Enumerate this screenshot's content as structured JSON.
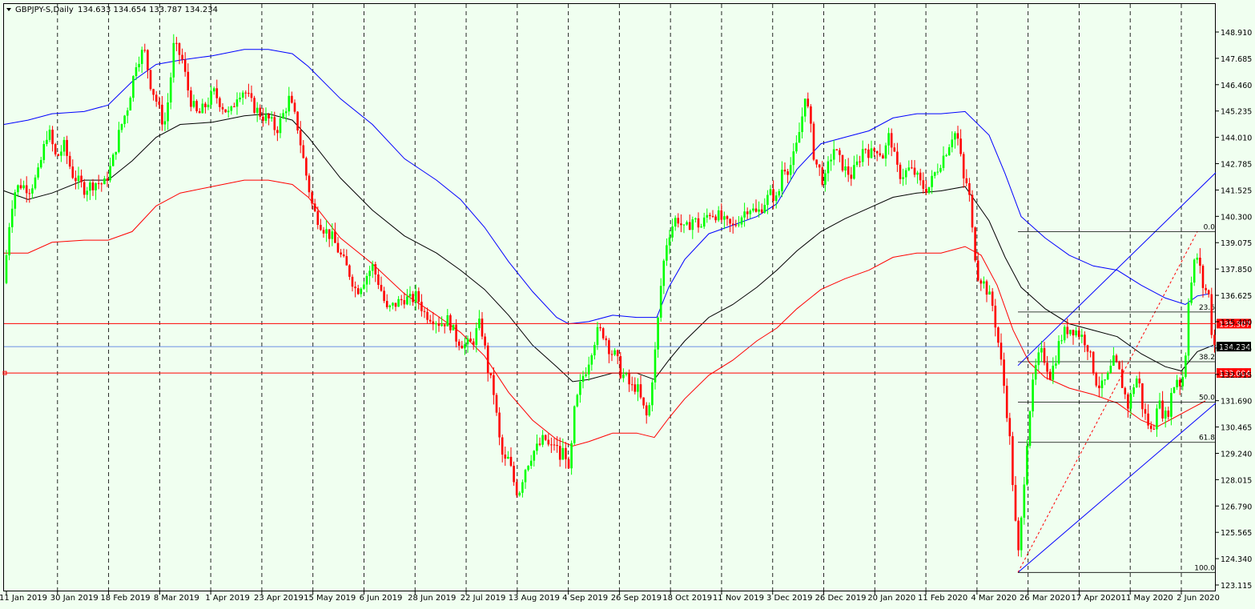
{
  "header": {
    "symbol": "GBPJPY-S,Daily",
    "ohlc": "134.633 134.654 133.787 134.234"
  },
  "chart_data": {
    "type": "candlestick",
    "symbol": "GBPJPY-S",
    "timeframe": "Daily",
    "ylim": [
      123.115,
      149.5
    ],
    "price_ticks": [
      "148.910",
      "147.685",
      "146.460",
      "145.235",
      "144.010",
      "142.785",
      "141.525",
      "140.300",
      "139.075",
      "137.850",
      "136.625",
      "135.400",
      "134.175",
      "132.915",
      "131.690",
      "130.465",
      "129.240",
      "128.015",
      "126.790",
      "125.565",
      "124.340",
      "123.115"
    ],
    "date_labels": [
      "11 Jan 2019",
      "30 Jan 2019",
      "18 Feb 2019",
      "8 Mar 2019",
      "1 Apr 2019",
      "23 Apr 2019",
      "15 May 2019",
      "6 Jun 2019",
      "28 Jun 2019",
      "22 Jul 2019",
      "13 Aug 2019",
      "4 Sep 2019",
      "26 Sep 2019",
      "18 Oct 2019",
      "11 Nov 2019",
      "3 Dec 2019",
      "26 Dec 2019",
      "20 Jan 2020",
      "11 Feb 2020",
      "4 Mar 2020",
      "26 Mar 2020",
      "17 Apr 2020",
      "11 May 2020",
      "2 Jun 2020"
    ],
    "price_path": [
      [
        0,
        137.2
      ],
      [
        6,
        139.8
      ],
      [
        12,
        141.4
      ],
      [
        20,
        141.8
      ],
      [
        32,
        141.6
      ],
      [
        42,
        142.2
      ],
      [
        55,
        144.4
      ],
      [
        65,
        143.0
      ],
      [
        75,
        143.6
      ],
      [
        85,
        142.3
      ],
      [
        100,
        141.6
      ],
      [
        115,
        141.9
      ],
      [
        125,
        141.8
      ],
      [
        135,
        142.8
      ],
      [
        145,
        144.4
      ],
      [
        155,
        145.5
      ],
      [
        165,
        147.5
      ],
      [
        175,
        148.1
      ],
      [
        183,
        146.5
      ],
      [
        192,
        145.5
      ],
      [
        200,
        144.5
      ],
      [
        206,
        146.0
      ],
      [
        212,
        148.3
      ],
      [
        222,
        147.7
      ],
      [
        232,
        145.8
      ],
      [
        242,
        145.0
      ],
      [
        252,
        145.5
      ],
      [
        262,
        146.1
      ],
      [
        272,
        145.5
      ],
      [
        282,
        145.0
      ],
      [
        292,
        146.1
      ],
      [
        300,
        146.2
      ],
      [
        310,
        145.5
      ],
      [
        322,
        145.0
      ],
      [
        332,
        144.8
      ],
      [
        340,
        144.3
      ],
      [
        348,
        145.0
      ],
      [
        356,
        145.8
      ],
      [
        366,
        144.6
      ],
      [
        376,
        142.5
      ],
      [
        386,
        140.6
      ],
      [
        398,
        139.8
      ],
      [
        410,
        139.3
      ],
      [
        420,
        138.5
      ],
      [
        432,
        137.6
      ],
      [
        440,
        136.8
      ],
      [
        450,
        137.4
      ],
      [
        460,
        138.0
      ],
      [
        470,
        137.0
      ],
      [
        478,
        135.9
      ],
      [
        488,
        136.2
      ],
      [
        500,
        136.5
      ],
      [
        508,
        136.4
      ],
      [
        515,
        136.6
      ],
      [
        525,
        135.8
      ],
      [
        535,
        135.6
      ],
      [
        545,
        135.3
      ],
      [
        555,
        135.5
      ],
      [
        565,
        134.6
      ],
      [
        575,
        134.3
      ],
      [
        585,
        134.4
      ],
      [
        593,
        135.3
      ],
      [
        598,
        134.8
      ],
      [
        604,
        133.2
      ],
      [
        612,
        132.0
      ],
      [
        618,
        130.0
      ],
      [
        624,
        128.8
      ],
      [
        630,
        129.0
      ],
      [
        636,
        128.0
      ],
      [
        642,
        127.3
      ],
      [
        650,
        128.5
      ],
      [
        660,
        129.3
      ],
      [
        668,
        129.6
      ],
      [
        675,
        130.0
      ],
      [
        682,
        129.4
      ],
      [
        688,
        129.8
      ],
      [
        694,
        129.0
      ],
      [
        700,
        129.6
      ],
      [
        706,
        128.0
      ],
      [
        711,
        131.0
      ],
      [
        717,
        132.0
      ],
      [
        722,
        132.8
      ],
      [
        728,
        133.3
      ],
      [
        735,
        134.3
      ],
      [
        742,
        135.0
      ],
      [
        750,
        134.8
      ],
      [
        757,
        134.0
      ],
      [
        764,
        133.8
      ],
      [
        770,
        133.0
      ],
      [
        776,
        132.8
      ],
      [
        783,
        132.3
      ],
      [
        790,
        132.4
      ],
      [
        797,
        131.5
      ],
      [
        804,
        130.8
      ],
      [
        810,
        133.0
      ],
      [
        814,
        134.3
      ],
      [
        820,
        137.0
      ],
      [
        826,
        138.9
      ],
      [
        832,
        139.7
      ],
      [
        840,
        140.3
      ],
      [
        850,
        139.6
      ],
      [
        860,
        140.2
      ],
      [
        870,
        139.8
      ],
      [
        880,
        140.5
      ],
      [
        890,
        140.4
      ],
      [
        900,
        140.0
      ],
      [
        910,
        139.8
      ],
      [
        920,
        140.3
      ],
      [
        930,
        140.8
      ],
      [
        940,
        140.4
      ],
      [
        950,
        141.0
      ],
      [
        958,
        141.4
      ],
      [
        966,
        141.0
      ],
      [
        972,
        142.7
      ],
      [
        980,
        142.5
      ],
      [
        988,
        143.3
      ],
      [
        996,
        144.8
      ],
      [
        1000,
        146.1
      ],
      [
        1006,
        144.8
      ],
      [
        1012,
        142.9
      ],
      [
        1018,
        142.5
      ],
      [
        1024,
        141.8
      ],
      [
        1030,
        142.8
      ],
      [
        1036,
        143.5
      ],
      [
        1042,
        143.0
      ],
      [
        1050,
        142.5
      ],
      [
        1058,
        142.2
      ],
      [
        1066,
        142.8
      ],
      [
        1074,
        143.6
      ],
      [
        1082,
        143.2
      ],
      [
        1090,
        143.5
      ],
      [
        1098,
        143.1
      ],
      [
        1106,
        144.2
      ],
      [
        1114,
        142.6
      ],
      [
        1120,
        142.2
      ],
      [
        1130,
        142.5
      ],
      [
        1138,
        142.3
      ],
      [
        1146,
        141.7
      ],
      [
        1154,
        141.6
      ],
      [
        1162,
        142.3
      ],
      [
        1170,
        142.9
      ],
      [
        1178,
        143.5
      ],
      [
        1186,
        144.3
      ],
      [
        1192,
        143.8
      ],
      [
        1198,
        142.0
      ],
      [
        1204,
        141.8
      ],
      [
        1210,
        139.2
      ],
      [
        1216,
        137.6
      ],
      [
        1222,
        137.3
      ],
      [
        1228,
        136.8
      ],
      [
        1234,
        136.2
      ],
      [
        1240,
        134.8
      ],
      [
        1246,
        133.2
      ],
      [
        1250,
        132.0
      ],
      [
        1256,
        129.8
      ],
      [
        1262,
        126.5
      ],
      [
        1266,
        124.3
      ],
      [
        1270,
        126.0
      ],
      [
        1276,
        129.3
      ],
      [
        1282,
        131.8
      ],
      [
        1288,
        133.2
      ],
      [
        1294,
        134.0
      ],
      [
        1300,
        133.6
      ],
      [
        1306,
        132.9
      ],
      [
        1312,
        133.5
      ],
      [
        1318,
        134.5
      ],
      [
        1324,
        134.9
      ],
      [
        1330,
        135.1
      ],
      [
        1338,
        135.0
      ],
      [
        1346,
        134.7
      ],
      [
        1352,
        134.4
      ],
      [
        1358,
        133.5
      ],
      [
        1364,
        132.6
      ],
      [
        1370,
        132.3
      ],
      [
        1378,
        132.8
      ],
      [
        1386,
        133.6
      ],
      [
        1392,
        133.1
      ],
      [
        1398,
        132.2
      ],
      [
        1404,
        131.4
      ],
      [
        1410,
        132.4
      ],
      [
        1416,
        132.9
      ],
      [
        1422,
        131.3
      ],
      [
        1428,
        130.7
      ],
      [
        1434,
        130.1
      ],
      [
        1440,
        131.8
      ],
      [
        1446,
        131.2
      ],
      [
        1452,
        130.9
      ],
      [
        1458,
        132.1
      ],
      [
        1464,
        132.8
      ],
      [
        1470,
        132.4
      ],
      [
        1475,
        133.7
      ],
      [
        1479,
        136.5
      ],
      [
        1484,
        137.5
      ],
      [
        1488,
        138.6
      ],
      [
        1492,
        138.2
      ],
      [
        1496,
        137.1
      ],
      [
        1500,
        136.9
      ],
      [
        1504,
        136.7
      ],
      [
        1508,
        134.9
      ],
      [
        1512,
        134.2
      ]
    ],
    "bollinger_upper": [
      [
        0,
        144.6
      ],
      [
        30,
        144.8
      ],
      [
        60,
        145.1
      ],
      [
        100,
        145.2
      ],
      [
        130,
        145.5
      ],
      [
        160,
        146.6
      ],
      [
        190,
        147.4
      ],
      [
        220,
        147.6
      ],
      [
        260,
        147.8
      ],
      [
        300,
        148.1
      ],
      [
        330,
        148.1
      ],
      [
        360,
        147.9
      ],
      [
        380,
        147.3
      ],
      [
        420,
        145.8
      ],
      [
        460,
        144.6
      ],
      [
        500,
        143.0
      ],
      [
        540,
        142.0
      ],
      [
        570,
        141.1
      ],
      [
        600,
        139.8
      ],
      [
        630,
        138.2
      ],
      [
        660,
        136.8
      ],
      [
        690,
        135.6
      ],
      [
        705,
        135.3
      ],
      [
        730,
        135.4
      ],
      [
        760,
        135.7
      ],
      [
        790,
        135.6
      ],
      [
        815,
        135.6
      ],
      [
        830,
        137.0
      ],
      [
        850,
        138.3
      ],
      [
        880,
        139.5
      ],
      [
        910,
        139.9
      ],
      [
        940,
        140.3
      ],
      [
        965,
        140.9
      ],
      [
        990,
        142.5
      ],
      [
        1020,
        143.7
      ],
      [
        1050,
        144.0
      ],
      [
        1080,
        144.3
      ],
      [
        1110,
        144.9
      ],
      [
        1140,
        145.1
      ],
      [
        1170,
        145.1
      ],
      [
        1200,
        145.2
      ],
      [
        1230,
        144.1
      ],
      [
        1250,
        142.3
      ],
      [
        1270,
        140.3
      ],
      [
        1300,
        139.3
      ],
      [
        1330,
        138.5
      ],
      [
        1360,
        138.0
      ],
      [
        1390,
        137.8
      ],
      [
        1420,
        137.1
      ],
      [
        1450,
        136.5
      ],
      [
        1475,
        136.2
      ],
      [
        1490,
        136.6
      ],
      [
        1505,
        136.7
      ]
    ],
    "bollinger_middle": [
      [
        0,
        141.5
      ],
      [
        30,
        141.1
      ],
      [
        60,
        141.4
      ],
      [
        100,
        142.0
      ],
      [
        130,
        142.0
      ],
      [
        160,
        142.9
      ],
      [
        190,
        144.0
      ],
      [
        220,
        144.6
      ],
      [
        260,
        144.7
      ],
      [
        300,
        145.0
      ],
      [
        330,
        145.1
      ],
      [
        360,
        144.8
      ],
      [
        380,
        144.0
      ],
      [
        420,
        142.1
      ],
      [
        460,
        140.6
      ],
      [
        500,
        139.4
      ],
      [
        540,
        138.6
      ],
      [
        570,
        137.8
      ],
      [
        600,
        136.9
      ],
      [
        630,
        135.7
      ],
      [
        660,
        134.3
      ],
      [
        690,
        133.3
      ],
      [
        710,
        132.6
      ],
      [
        730,
        132.7
      ],
      [
        760,
        133.0
      ],
      [
        790,
        133.0
      ],
      [
        812,
        132.7
      ],
      [
        830,
        133.6
      ],
      [
        850,
        134.5
      ],
      [
        880,
        135.6
      ],
      [
        910,
        136.2
      ],
      [
        940,
        137.0
      ],
      [
        965,
        137.8
      ],
      [
        990,
        138.7
      ],
      [
        1020,
        139.6
      ],
      [
        1050,
        140.2
      ],
      [
        1080,
        140.7
      ],
      [
        1110,
        141.2
      ],
      [
        1140,
        141.4
      ],
      [
        1170,
        141.5
      ],
      [
        1200,
        141.7
      ],
      [
        1230,
        140.1
      ],
      [
        1250,
        138.4
      ],
      [
        1270,
        137.0
      ],
      [
        1300,
        136.0
      ],
      [
        1330,
        135.3
      ],
      [
        1360,
        135.0
      ],
      [
        1390,
        134.7
      ],
      [
        1420,
        133.9
      ],
      [
        1450,
        133.3
      ],
      [
        1470,
        133.1
      ],
      [
        1490,
        134.0
      ],
      [
        1510,
        134.3
      ]
    ],
    "bollinger_lower": [
      [
        0,
        138.6
      ],
      [
        30,
        138.6
      ],
      [
        60,
        139.1
      ],
      [
        100,
        139.2
      ],
      [
        130,
        139.2
      ],
      [
        160,
        139.6
      ],
      [
        190,
        140.8
      ],
      [
        220,
        141.4
      ],
      [
        260,
        141.7
      ],
      [
        300,
        142.0
      ],
      [
        330,
        142.0
      ],
      [
        360,
        141.8
      ],
      [
        380,
        141.2
      ],
      [
        420,
        139.3
      ],
      [
        460,
        138.1
      ],
      [
        500,
        136.7
      ],
      [
        540,
        135.7
      ],
      [
        570,
        134.9
      ],
      [
        600,
        133.8
      ],
      [
        630,
        132.1
      ],
      [
        660,
        130.8
      ],
      [
        690,
        129.9
      ],
      [
        710,
        129.6
      ],
      [
        730,
        129.8
      ],
      [
        760,
        130.2
      ],
      [
        790,
        130.2
      ],
      [
        812,
        130.0
      ],
      [
        830,
        130.9
      ],
      [
        850,
        131.8
      ],
      [
        880,
        132.9
      ],
      [
        910,
        133.6
      ],
      [
        940,
        134.5
      ],
      [
        965,
        135.1
      ],
      [
        990,
        136.0
      ],
      [
        1020,
        136.9
      ],
      [
        1050,
        137.4
      ],
      [
        1080,
        137.8
      ],
      [
        1110,
        138.4
      ],
      [
        1140,
        138.6
      ],
      [
        1170,
        138.6
      ],
      [
        1200,
        138.9
      ],
      [
        1220,
        138.5
      ],
      [
        1240,
        137.1
      ],
      [
        1260,
        135.0
      ],
      [
        1280,
        133.5
      ],
      [
        1300,
        132.8
      ],
      [
        1330,
        132.3
      ],
      [
        1360,
        132.0
      ],
      [
        1390,
        131.6
      ],
      [
        1420,
        130.8
      ],
      [
        1440,
        130.5
      ],
      [
        1460,
        130.9
      ],
      [
        1480,
        131.3
      ],
      [
        1500,
        131.7
      ]
    ],
    "horizontal_lines": [
      {
        "label": "135.307",
        "price": 135.307,
        "color": "#ff0000"
      },
      {
        "label": "133.004",
        "price": 133.004,
        "color": "#ff0000"
      }
    ],
    "current_price": {
      "label": "134.234",
      "price": 134.234
    },
    "fibonacci": {
      "start": {
        "x": 1266,
        "price": 123.7
      },
      "end": {
        "x": 1490,
        "price": 139.6
      },
      "levels": [
        {
          "label": "0.0",
          "price": 139.6
        },
        {
          "label": "23.6",
          "price": 135.85
        },
        {
          "label": "38.2",
          "price": 133.53
        },
        {
          "label": "50.0",
          "price": 131.65
        },
        {
          "label": "61.8",
          "price": 129.77
        },
        {
          "label": "100.0",
          "price": 123.7
        }
      ]
    },
    "channel_lines": [
      {
        "p1": {
          "x": 1266,
          "price": 123.7
        },
        "p2": {
          "x": 1518,
          "price": 131.6
        }
      },
      {
        "p1": {
          "x": 1266,
          "price": 133.35
        },
        "p2": {
          "x": 1518,
          "price": 142.35
        }
      }
    ],
    "colors": {
      "background": "#f0fff0",
      "bull": "#00ff00",
      "bear": "#ff0000",
      "upper_band": "#0000ff",
      "middle_band": "#000000",
      "lower_band": "#ff0000",
      "channel": "#0000ff",
      "fib": "#000000",
      "current_line": "#4169e1",
      "grid": "#000000"
    }
  }
}
